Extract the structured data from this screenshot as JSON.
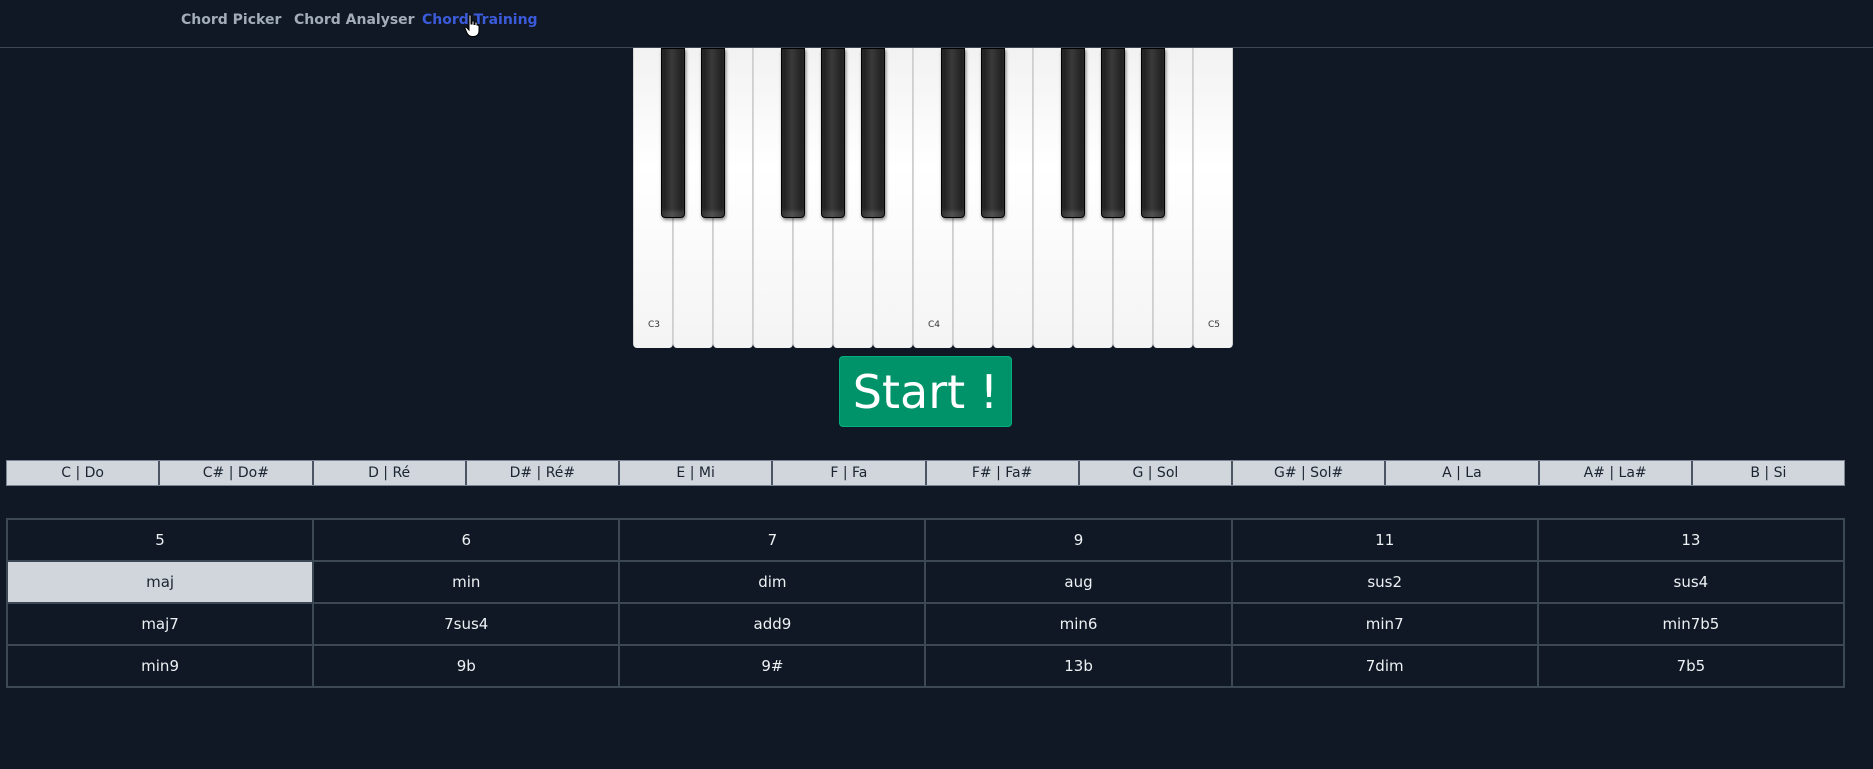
{
  "nav": {
    "items": [
      {
        "label": "Chord Picker"
      },
      {
        "label": "Chord Analyser"
      },
      {
        "label": "Chord Training"
      }
    ],
    "active_index": 2,
    "active_color": "#3b5bdb"
  },
  "piano": {
    "white_keys": [
      "C3",
      "D3",
      "E3",
      "F3",
      "G3",
      "A3",
      "B3",
      "C4",
      "D4",
      "E4",
      "F4",
      "G4",
      "A4",
      "B4",
      "C5"
    ],
    "labels": {
      "c3": "C3",
      "c4": "C4",
      "c5": "C5"
    }
  },
  "start_button": {
    "label": "Start !",
    "color": "#00936a"
  },
  "notes": [
    "C | Do",
    "C# | Do#",
    "D | Ré",
    "D# | Ré#",
    "E | Mi",
    "F | Fa",
    "F# | Fa#",
    "G | Sol",
    "G# | Sol#",
    "A | La",
    "A# | La#",
    "B | Si"
  ],
  "chords": {
    "rows": [
      [
        "5",
        "6",
        "7",
        "9",
        "11",
        "13"
      ],
      [
        "maj",
        "min",
        "dim",
        "aug",
        "sus2",
        "sus4"
      ],
      [
        "maj7",
        "7sus4",
        "add9",
        "min6",
        "min7",
        "min7b5"
      ],
      [
        "min9",
        "9b",
        "9#",
        "13b",
        "7dim",
        "7b5"
      ]
    ],
    "selected": "maj"
  },
  "icons": {
    "cursor": "hand-pointer-icon"
  }
}
